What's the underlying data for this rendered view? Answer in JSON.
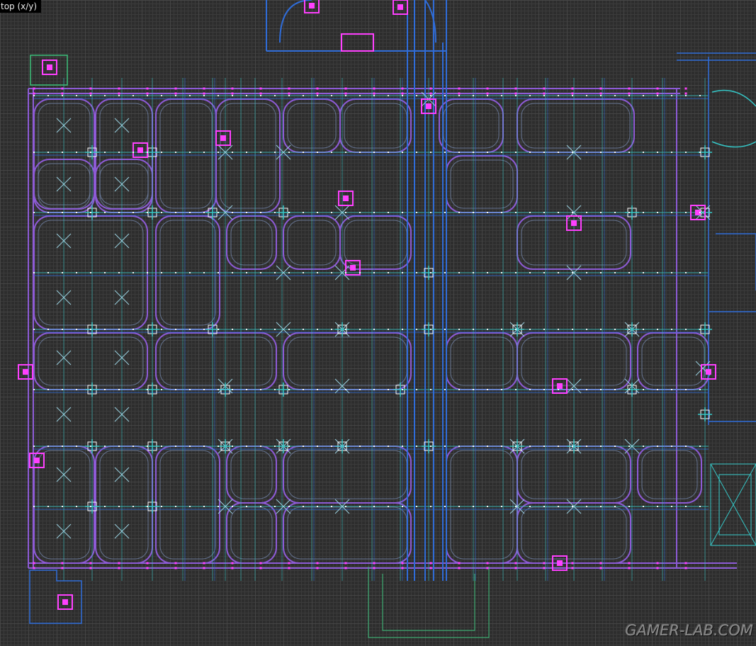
{
  "viewport": {
    "label": "top (x/y)",
    "background": "#2d2d2d",
    "grid_minor_color": "#3b3b3b",
    "grid_major_color": "#454545",
    "colors": {
      "brush_cyan": "#35c8c8",
      "brush_blue": "#2f6cd8",
      "brush_purple": "#8d5bd6",
      "vertex_magenta": "#ff40ff",
      "vertex_white": "#ffffff",
      "brush_green": "#3cc07a"
    }
  },
  "watermark": {
    "text": "GAMER-LAB.COM",
    "color": "#8a8a8a"
  }
}
